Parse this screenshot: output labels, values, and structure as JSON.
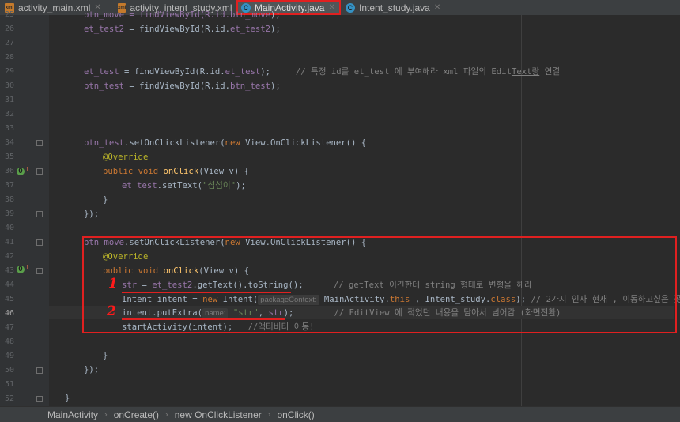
{
  "tabs": [
    {
      "label": "activity_main.xml",
      "kind": "xml"
    },
    {
      "label": "activity_intent_study.xml",
      "kind": "xml"
    },
    {
      "label": "MainActivity.java",
      "kind": "class"
    },
    {
      "label": "Intent_study.java",
      "kind": "class"
    }
  ],
  "active_tab": "MainActivity.java",
  "line_numbers": [
    "25",
    "26",
    "27",
    "28",
    "29",
    "30",
    "31",
    "32",
    "33",
    "34",
    "35",
    "36",
    "37",
    "38",
    "39",
    "40",
    "41",
    "42",
    "43",
    "44",
    "45",
    "46",
    "47",
    "48",
    "49",
    "50",
    "51",
    "52"
  ],
  "code": {
    "l25": {
      "a": "btn_move = findViewById(R.id.",
      "b": "btn_move",
      "c": ");"
    },
    "l26": {
      "a": "et_test2",
      "b": " = findViewById(R.id.",
      "c": "et_test2",
      "d": ");"
    },
    "l29": {
      "a": "et_test",
      "b": " = findViewById(R.id.",
      "c": "et_test",
      "d": ");",
      "e": "// 특정 id를 et_test 에 부여해라 xml 파일의 Edit",
      "f": "Text랑",
      "g": " 연결"
    },
    "l30": {
      "a": "btn_test",
      "b": " = findViewById(R.id.",
      "c": "btn_test",
      "d": ");"
    },
    "l34": {
      "a": "btn_test",
      "b": ".setOnClickListener(",
      "c": "new",
      "d": " View.OnClickListener() {"
    },
    "l35": {
      "a": "@Override"
    },
    "l36": {
      "a": "public void ",
      "b": "onClick",
      "c": "(View v) {"
    },
    "l37": {
      "a": "et_test",
      "b": ".setText(",
      "c": "\"섭섭이\"",
      "d": ");"
    },
    "l38": {
      "a": "}"
    },
    "l39": {
      "a": "});"
    },
    "l41": {
      "a": "btn_move",
      "b": ".setOnClickListener(",
      "c": "new",
      "d": " View.OnClickListener() {"
    },
    "l42": {
      "a": "@Override"
    },
    "l43": {
      "a": "public void ",
      "b": "onClick",
      "c": "(View v) {"
    },
    "l44": {
      "a": "str",
      "b": " = ",
      "c": "et_test2",
      "d": ".getText().toString();",
      "e": "// getText 이긴한데 string 형태로 변형을 해라"
    },
    "l45": {
      "a": "Intent intent = ",
      "b": "new",
      "c": " Intent(",
      "hint": "packageContext:",
      "d": " MainActivity.",
      "e": "this",
      "f": " , Intent_study.",
      "g": "class",
      "h": "); ",
      "i": "// 2가지 인자 현재 , 이동하고싶은 곳"
    },
    "l46": {
      "a": "intent.putExtra(",
      "hint": "name:",
      "b": " \"str\"",
      "c": ", ",
      "d": "str",
      "e": ");",
      "f": "// EditView 에 적었던 내용을 담아서 넘어감 (화면전환)"
    },
    "l47": {
      "a": "startActivity(intent);",
      "b": "//액티비티 이동!"
    },
    "l49": {
      "a": "}"
    },
    "l50": {
      "a": "});"
    },
    "l52": {
      "a": "}"
    }
  },
  "annotations": {
    "mark1": "1",
    "mark2": "2"
  },
  "breadcrumbs": [
    "MainActivity",
    "onCreate()",
    "new OnClickListener",
    "onClick()"
  ],
  "colors": {
    "keyword": "#cc7832",
    "field": "#9876aa",
    "string": "#6a8759",
    "annotation": "#bbb529",
    "comment": "#808080",
    "method": "#ffc66d",
    "highlight": "#e02020"
  }
}
